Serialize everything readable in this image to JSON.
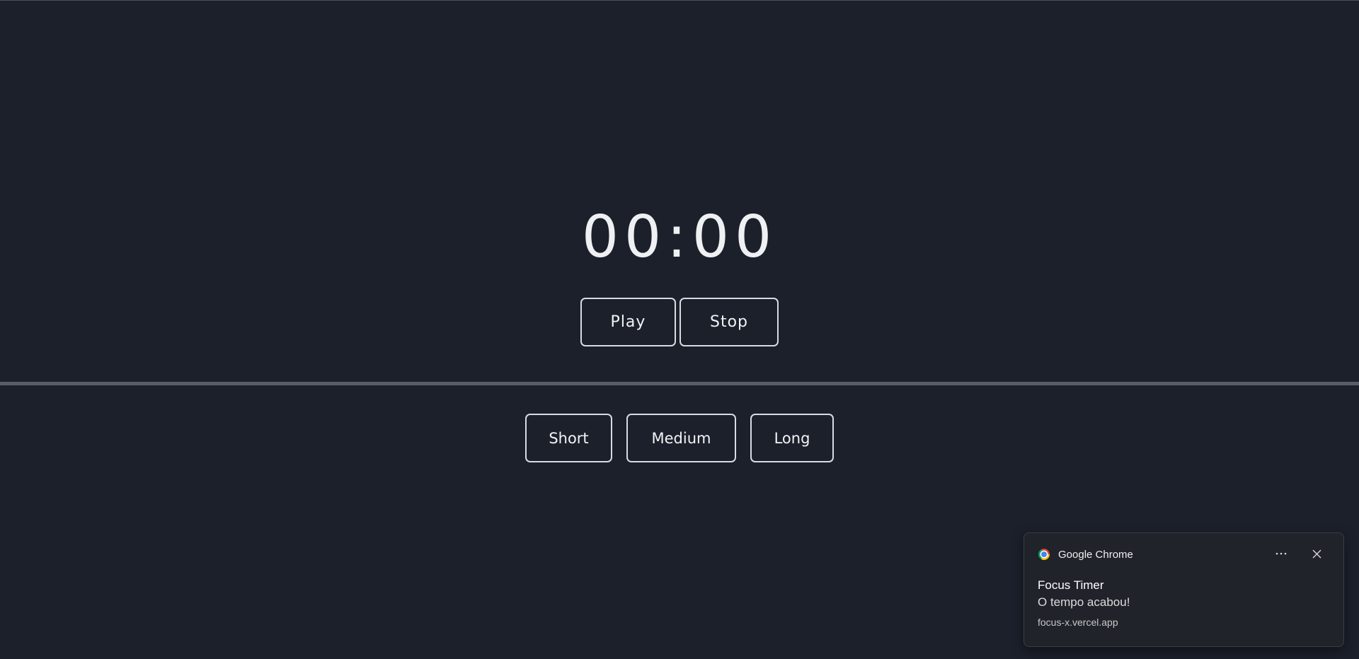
{
  "timer": {
    "display": "00:00"
  },
  "controls": {
    "play_label": "Play",
    "stop_label": "Stop"
  },
  "presets": {
    "short_label": "Short",
    "medium_label": "Medium",
    "long_label": "Long"
  },
  "notification": {
    "app_name": "Google Chrome",
    "app_icon": "chrome-icon",
    "more_icon": "more-options-icon",
    "close_icon": "close-icon",
    "title": "Focus Timer",
    "body": "O tempo acabou!",
    "source": "focus-x.vercel.app"
  },
  "colors": {
    "background": "#1c202b",
    "text": "#eef0f3",
    "button_border": "#d9dbe0",
    "divider": "#5a5d66",
    "toast_background": "#20232a"
  }
}
